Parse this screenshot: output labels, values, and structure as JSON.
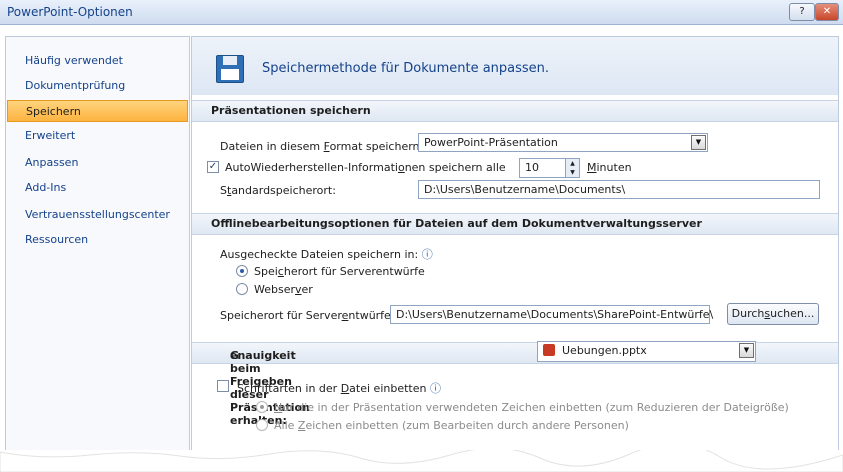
{
  "window": {
    "title": "PowerPoint-Optionen"
  },
  "titlebar": {
    "help_label": "?",
    "close_label": "✕"
  },
  "sidebar": {
    "items": [
      {
        "label": "Häufig verwendet"
      },
      {
        "label": "Dokumentprüfung"
      },
      {
        "label": "Speichern"
      },
      {
        "label": "Erweitert"
      },
      {
        "label": "Anpassen"
      },
      {
        "label": "Add-Ins"
      },
      {
        "label": "Vertrauensstellungscenter"
      },
      {
        "label": "Ressourcen"
      }
    ]
  },
  "header": {
    "title": "Speichermethode für Dokumente anpassen."
  },
  "sections": {
    "save": {
      "title": "Präsentationen speichern",
      "format_label_a": "Dateien in diesem ",
      "format_label_u": "F",
      "format_label_b": "ormat speichern:",
      "format_value": "PowerPoint-Präsentation",
      "autosave_checked": "✓",
      "autosave_label_a": "AutoWiederherstellen-Informati",
      "autosave_label_u": "o",
      "autosave_label_b": "nen speichern alle",
      "autosave_minutes": "10",
      "minutes_label_u": "M",
      "minutes_label_b": "inuten",
      "location_label_a": "S",
      "location_label_u": "t",
      "location_label_b": "andardspeicherort:",
      "location_value": "D:\\Users\\Benutzername\\Documents\\"
    },
    "offline": {
      "title": "Offlinebearbeitungsoptionen für Dateien auf dem Dokumentverwaltungsserver",
      "checked_out_label": "Ausgecheckte Dateien speichern in:",
      "info_icon": "ⓘ",
      "option_server_a": "Spei",
      "option_server_u": "c",
      "option_server_b": "herort für Serverentwürfe",
      "option_web_a": "Webser",
      "option_web_u": "v",
      "option_web_b": "er",
      "draft_label_a": "Speicherort für Server",
      "draft_label_u": "e",
      "draft_label_b": "ntwürfe:",
      "draft_value": "D:\\Users\\Benutzername\\Documents\\SharePoint-Entwürfe\\",
      "browse_a": "Durch",
      "browse_u": "s",
      "browse_b": "uchen..."
    },
    "fidelity": {
      "title_u": "G",
      "title_b": "enauigkeit beim Freigeben dieser Präsentation erhalten:",
      "file_value": "Uebungen.pptx",
      "embed_label_a": "Schriftarten in der ",
      "embed_label_u": "D",
      "embed_label_b": "atei einbetten",
      "embed_option1_u": "N",
      "embed_option1_b": "ur die in der Präsentation verwendeten Zeichen einbetten (zum Reduzieren der Dateigröße)",
      "embed_option2_a": "Alle ",
      "embed_option2_u": "Z",
      "embed_option2_b": "eichen einbetten (zum Bearbeiten durch andere Personen)"
    }
  },
  "colors": {
    "accent": "#15428b",
    "selected_nav": "#fdb340",
    "header_bg": "#eef3fa"
  }
}
